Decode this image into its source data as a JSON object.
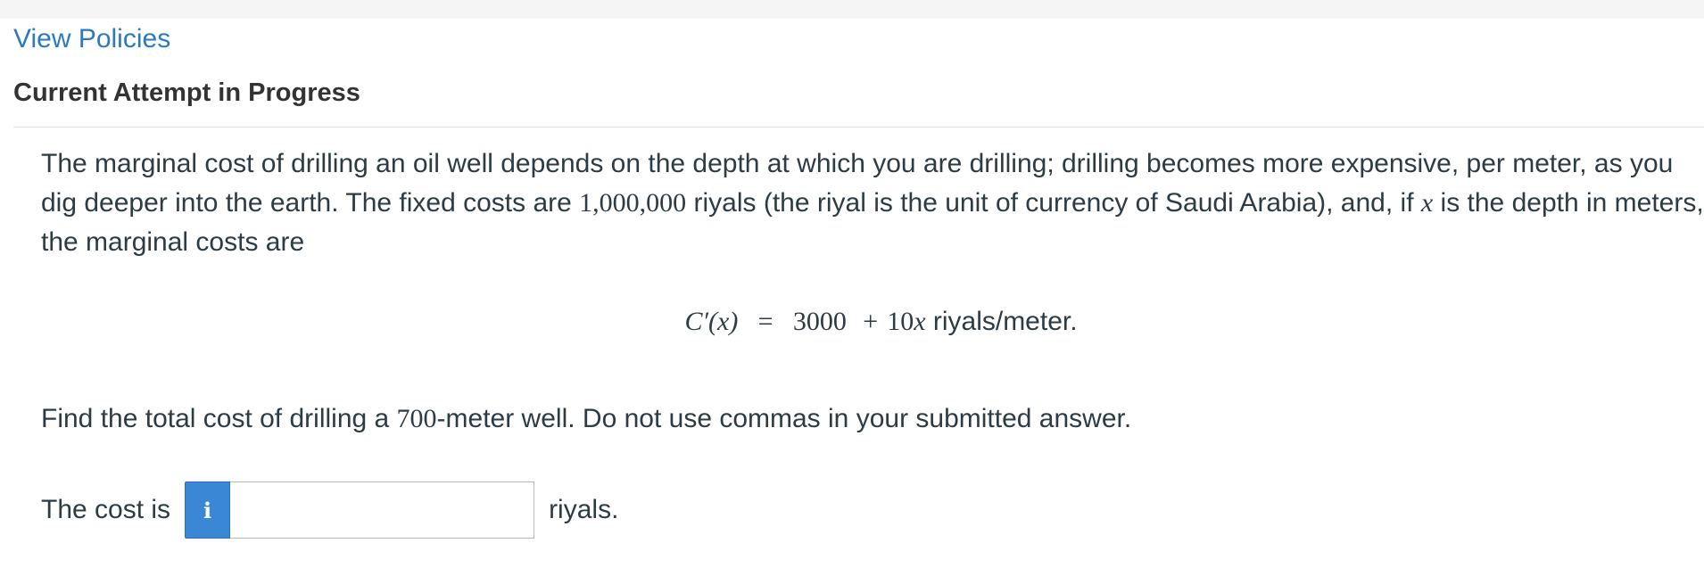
{
  "header": {
    "view_policies": "View Policies",
    "attempt_status": "Current Attempt in Progress"
  },
  "question": {
    "p1_a": "The marginal cost of drilling an oil well depends on the depth at which you are drilling; drilling becomes more expensive, per meter, as you dig deeper into the earth. The fixed costs are ",
    "fixed_cost": "1,000,000",
    "p1_b": " riyals (the riyal is the unit of currency of Saudi Arabia), and, if ",
    "var_x": "x",
    "p1_c": " is the depth in meters, the marginal costs are",
    "equation": {
      "lhs": "C′(x)",
      "eq": "=",
      "const": "3000",
      "plus": "+",
      "coef": "10",
      "var": "x",
      "unit": " riyals/meter."
    },
    "prompt_a": "Find the total cost of drilling a ",
    "depth": "700",
    "prompt_b": "-meter well. Do not use commas in your submitted answer."
  },
  "answer": {
    "label": "The cost is",
    "info_icon_glyph": "i",
    "input_value": "",
    "unit": "riyals."
  },
  "colors": {
    "link": "#2b7abc",
    "info_button": "#3a87d6",
    "text": "#2d3b45"
  }
}
